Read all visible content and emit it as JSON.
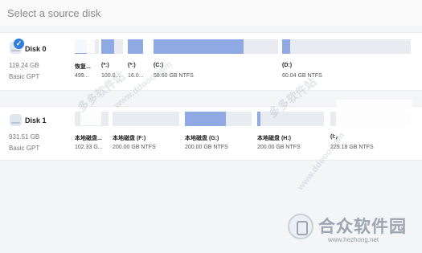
{
  "header": {
    "title": "Select a source disk"
  },
  "disks": [
    {
      "name": "Disk 0",
      "size": "119.24 GB",
      "type": "Basic GPT",
      "selected": true,
      "partitions": [
        {
          "label": "恢复...",
          "info": "499...",
          "used": 0.5
        },
        {
          "label": "(*:)",
          "info": "100.0...",
          "used": 0.6
        },
        {
          "label": "(*:)",
          "info": "16.0...",
          "used": 1.0
        },
        {
          "label": "(C:)",
          "info": "58.60 GB NTFS",
          "used": 0.72
        },
        {
          "label": "(D:)",
          "info": "60.04 GB NTFS",
          "used": 0.06
        }
      ]
    },
    {
      "name": "Disk 1",
      "size": "931.51 GB",
      "type": "Basic GPT",
      "selected": false,
      "partitions": [
        {
          "label": "本地磁盘...",
          "info": "102.33 G...",
          "used": 0.0
        },
        {
          "label": "本地磁盘 (F:)",
          "info": "200.00 GB NTFS",
          "used": 0.0
        },
        {
          "label": "本地磁盘 (G:)",
          "info": "200.00 GB NTFS",
          "used": 0.62
        },
        {
          "label": "本地磁盘 (H:)",
          "info": "200.00 GB NTFS",
          "used": 0.05
        },
        {
          "label": "(I:)",
          "info": "229.18 GB NTFS",
          "used": 0.0
        }
      ]
    }
  ],
  "watermarks": [
    "多多软件站",
    "www.ddooo.com",
    "多多软件站",
    "www.ddooo.com"
  ],
  "logo": {
    "name": "合众软件园",
    "url": "www.hezhong.net"
  },
  "colors": {
    "accent": "#2f7de1",
    "partition_fill": "#8fa9e4",
    "partition_empty": "#e8ebf0"
  }
}
